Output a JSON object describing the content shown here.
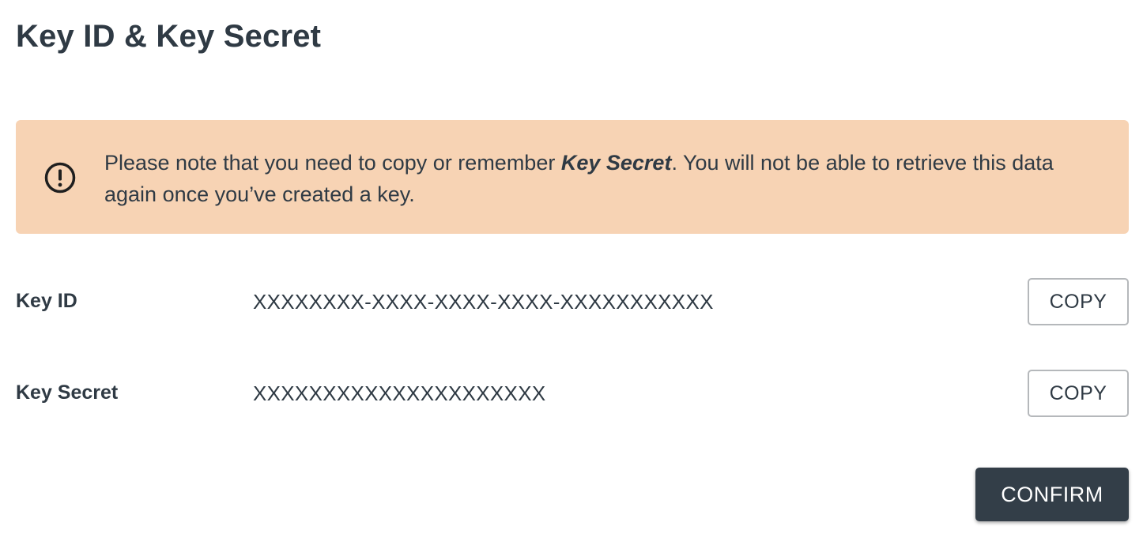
{
  "dialog": {
    "title": "Key ID & Key Secret"
  },
  "notice": {
    "icon": "exclamation-circle-icon",
    "text_before": "Please note that you need to copy or remember ",
    "text_emphasis": "Key Secret",
    "text_after": ". You will not be able to retrieve this data again once you’ve created a key."
  },
  "fields": {
    "key_id": {
      "label": "Key ID",
      "value": "XXXXXXXX-XXXX-XXXX-XXXX-XXXXXXXXXXX",
      "copy_label": "COPY"
    },
    "key_secret": {
      "label": "Key Secret",
      "value": "XXXXXXXXXXXXXXXXXXXXX",
      "copy_label": "COPY"
    }
  },
  "actions": {
    "confirm_label": "CONFIRM"
  },
  "colors": {
    "notice_background": "#f7d3b4",
    "text": "#2f3a44",
    "confirm_background": "#333e48",
    "copy_border": "#b5b8bb"
  }
}
